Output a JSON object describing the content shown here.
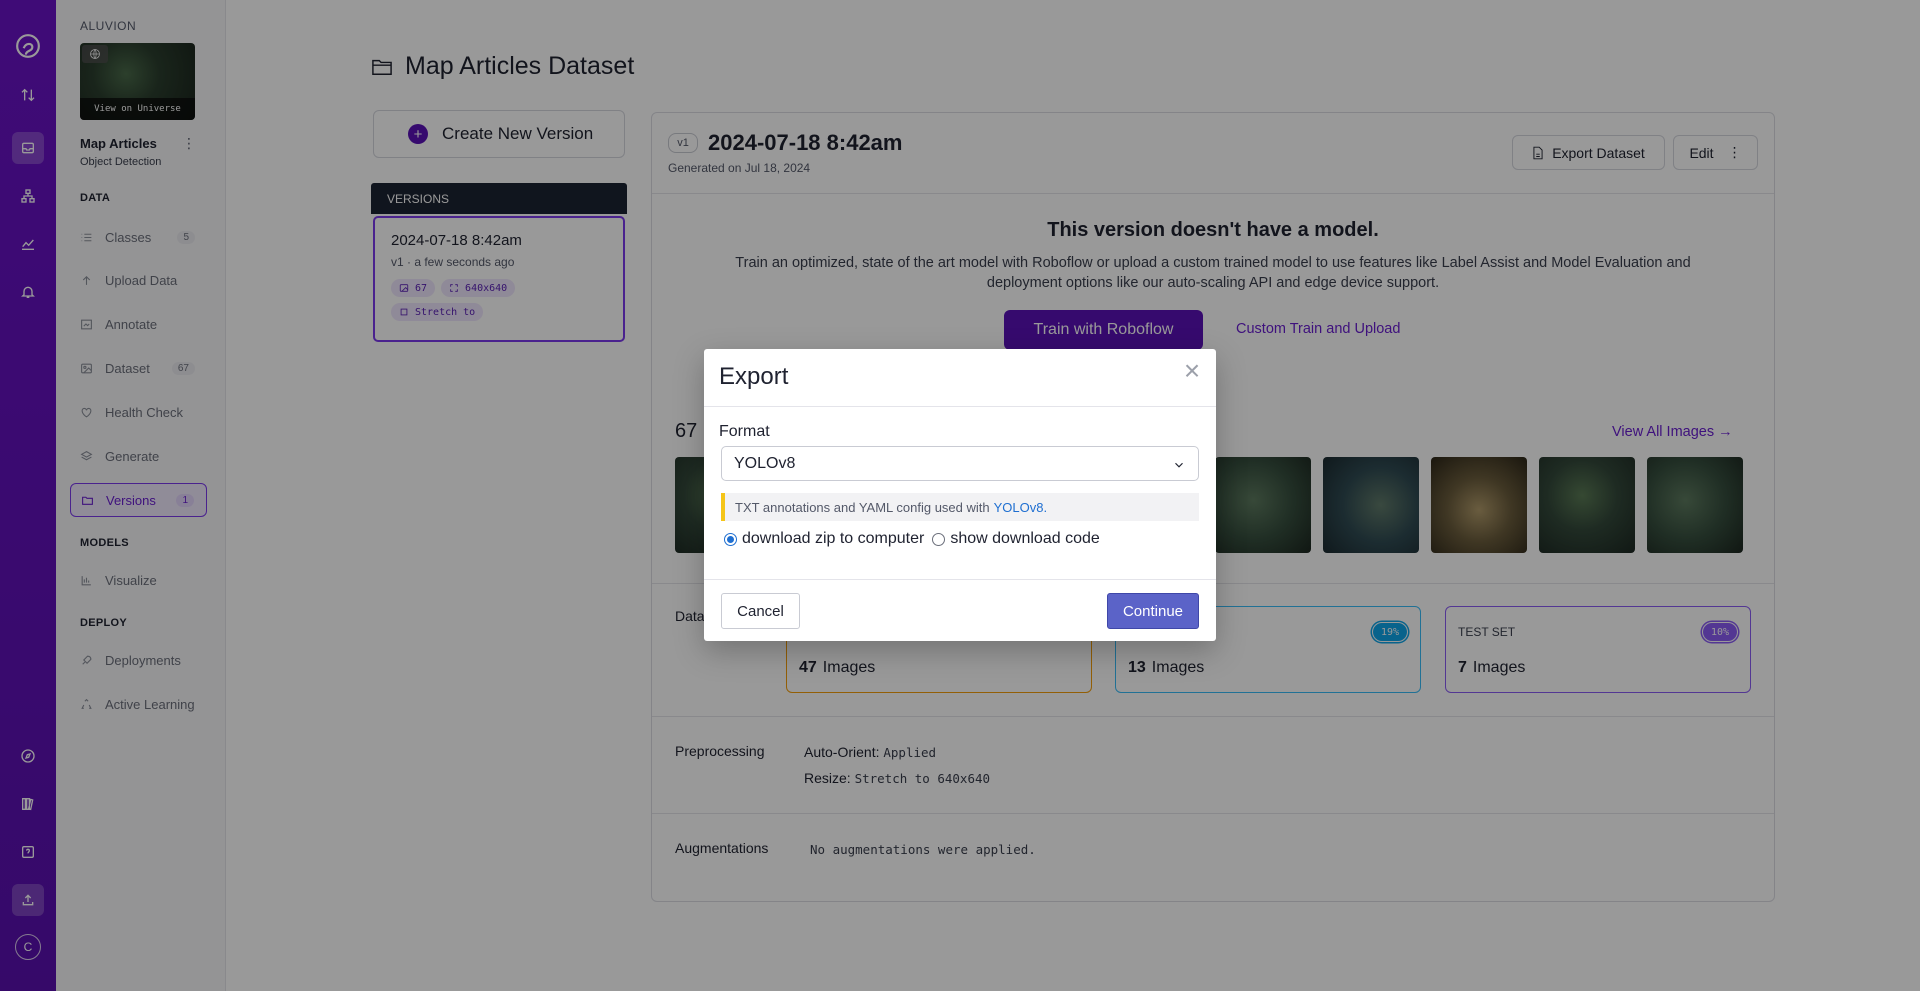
{
  "workspace": {
    "name": "ALUVION"
  },
  "project": {
    "thumbnail_label": "View on Universe",
    "name": "Map Articles",
    "type": "Object Detection"
  },
  "sidebar": {
    "sections": {
      "data": "DATA",
      "models": "MODELS",
      "deploy": "DEPLOY"
    },
    "items": [
      {
        "label": "Classes",
        "count": "5",
        "icon": "list-icon"
      },
      {
        "label": "Upload Data",
        "count": "",
        "icon": "upload-icon"
      },
      {
        "label": "Annotate",
        "count": "",
        "icon": "annotate-icon"
      },
      {
        "label": "Dataset",
        "count": "67",
        "icon": "image-icon"
      },
      {
        "label": "Health Check",
        "count": "",
        "icon": "heart-icon"
      },
      {
        "label": "Generate",
        "count": "",
        "icon": "layers-icon"
      },
      {
        "label": "Versions",
        "count": "1",
        "icon": "folder-icon"
      },
      {
        "label": "Visualize",
        "count": "",
        "icon": "chart-icon"
      },
      {
        "label": "Deployments",
        "count": "",
        "icon": "rocket-icon"
      },
      {
        "label": "Active Learning",
        "count": "",
        "icon": "recycle-icon"
      }
    ]
  },
  "main": {
    "title": "Map Articles Dataset",
    "create_version_label": "Create New Version",
    "versions_header": "VERSIONS",
    "version_card": {
      "title": "2024-07-18 8:42am",
      "subtitle": "v1 · a few seconds ago",
      "chip_images": "67",
      "chip_size": "640x640",
      "chip_resize": "Stretch to"
    }
  },
  "version": {
    "badge": "v1",
    "title": "2024-07-18 8:42am",
    "generated": "Generated on Jul 18, 2024",
    "export_label": "Export Dataset",
    "edit_label": "Edit",
    "no_model_title": "This version doesn't have a model.",
    "no_model_desc": "Train an optimized, state of the art model with Roboflow or upload a custom trained model to use features like Label Assist and Model Evaluation and deployment options like our auto-scaling API and edge device support.",
    "train_label": "Train with Roboflow",
    "custom_label": "Custom Train and Upload",
    "image_count": "67",
    "view_all_label": "View All Images →",
    "dataset_label": "Data",
    "splits": {
      "train": {
        "count": "47",
        "unit": "Images",
        "pct": ""
      },
      "valid": {
        "count": "13",
        "unit": "Images",
        "pct": "19%"
      },
      "test": {
        "label": "TEST SET",
        "count": "7",
        "unit": "Images",
        "pct": "10%"
      }
    },
    "preprocessing_label": "Preprocessing",
    "preprocessing": {
      "orient_key": "Auto-Orient:",
      "orient_val": "Applied",
      "resize_key": "Resize:",
      "resize_val": "Stretch to 640x640"
    },
    "augmentations_label": "Augmentations",
    "augmentations_value": "No augmentations were applied."
  },
  "modal": {
    "title": "Export",
    "close": "×",
    "format_label": "Format",
    "format_value": "YOLOv8",
    "hint_text": "TXT annotations and YAML config used with",
    "hint_link": "YOLOv8.",
    "radio_zip": "download zip to computer",
    "radio_code": "show download code",
    "cancel_label": "Cancel",
    "continue_label": "Continue"
  },
  "colors": {
    "accent": "#5b12b8",
    "rail": "#6a13c7",
    "continue": "#5b63c8",
    "train": "#f59e0b",
    "valid": "#0ea5e9",
    "test": "#8b5cf6"
  }
}
